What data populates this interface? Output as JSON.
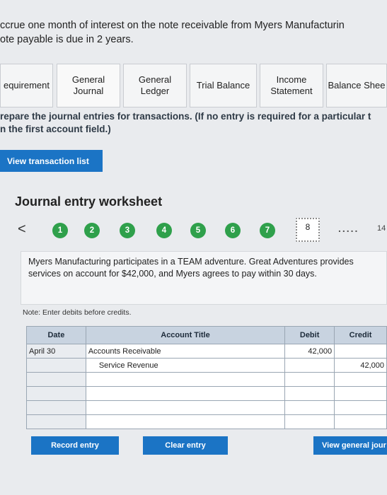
{
  "question": {
    "line1": "ccrue one month of interest on the note receivable from Myers Manufacturin",
    "line2": "ote payable is due in 2 years."
  },
  "tabs": [
    {
      "l1": "equirement",
      "l2": ""
    },
    {
      "l1": "General",
      "l2": "Journal"
    },
    {
      "l1": "General",
      "l2": "Ledger"
    },
    {
      "l1": "Trial Balance",
      "l2": ""
    },
    {
      "l1": "Income",
      "l2": "Statement"
    },
    {
      "l1": "Balance Shee",
      "l2": ""
    }
  ],
  "instructions": {
    "line1": "repare the journal entries for transactions. (If no entry is required for a particular t",
    "line2": "n the first account field.)"
  },
  "view_transaction_list": "View transaction list",
  "worksheet_title": "Journal entry worksheet",
  "stepper": {
    "prev": "<",
    "steps": [
      "1",
      "2",
      "3",
      "4",
      "5",
      "6",
      "7",
      "8"
    ],
    "current": "8",
    "dots": ".....",
    "last": "14"
  },
  "transaction_description": "Myers Manufacturing participates in a TEAM adventure. Great Adventures provides services on account for $42,000, and Myers agrees to pay within 30 days.",
  "note": "Note: Enter debits before credits.",
  "journal": {
    "headers": {
      "date": "Date",
      "account": "Account Title",
      "debit": "Debit",
      "credit": "Credit"
    },
    "rows": [
      {
        "date": "April 30",
        "account": "Accounts Receivable",
        "debit": "42,000",
        "credit": ""
      },
      {
        "date": "",
        "account": "Service Revenue",
        "debit": "",
        "credit": "42,000"
      },
      {
        "date": "",
        "account": "",
        "debit": "",
        "credit": ""
      },
      {
        "date": "",
        "account": "",
        "debit": "",
        "credit": ""
      },
      {
        "date": "",
        "account": "",
        "debit": "",
        "credit": ""
      },
      {
        "date": "",
        "account": "",
        "debit": "",
        "credit": ""
      }
    ]
  },
  "buttons": {
    "record": "Record entry",
    "clear": "Clear entry",
    "view_gj": "View general jour"
  }
}
